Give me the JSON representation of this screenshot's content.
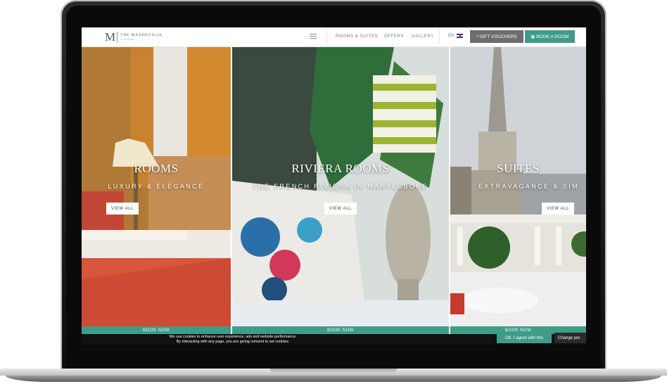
{
  "header": {
    "logo_mark": "M",
    "logo_name": "THE MANDEVILLE",
    "logo_sub": "LONDON",
    "nav": [
      "ROOMS & SUITES",
      "OFFERS",
      "GALLERY"
    ],
    "lang": "EN",
    "gift_vouchers": "GIFT VOUCHERS",
    "book_room": "BOOK A ROOM"
  },
  "panels": [
    {
      "title": "ROOMS",
      "subtitle": "LUXURY & ELEGANCE",
      "view_all": "VIEW ALL",
      "book_now": "BOOK NOW"
    },
    {
      "title": "RIVIERA ROOMS",
      "subtitle": "THE FRENCH RIVIERA IN MARYLEBONE",
      "view_all": "VIEW ALL",
      "book_now": "BOOK NOW"
    },
    {
      "title": "SUITES",
      "subtitle": "EXTRAVAGANCE & SIM",
      "view_all": "VIEW ALL",
      "book_now": "BOOK NOW"
    }
  ],
  "cookie": {
    "line1": "We use cookies to enhance user experience, ads and website performance.",
    "line2": "By interacting with any page, you are giving consent to set cookies.",
    "agree": "OK, I agree with this",
    "change": "Change pre"
  },
  "colors": {
    "accent": "#3e9c88",
    "voucher": "#6d6d6d",
    "cookie_bar": "#111111"
  }
}
